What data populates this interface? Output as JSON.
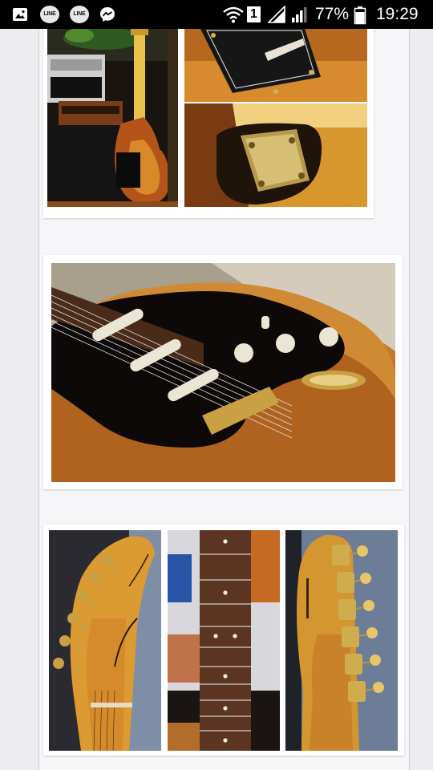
{
  "status_bar": {
    "notifications": [
      "gallery-icon",
      "line-icon",
      "line-icon",
      "messenger-icon"
    ],
    "line_label_1": "LINE",
    "line_label_2": "LINE",
    "sim_slot": "1",
    "battery_percent": "77%",
    "time": "19:29"
  },
  "colors": {
    "page_background": "#ececef",
    "column_background": "#f6f6f8",
    "card_background": "#ffffff"
  },
  "gallery": {
    "photos": [
      {
        "name": "amp-and-guitar-back",
        "icon": "photo"
      },
      {
        "name": "tremolo-cover-plate",
        "icon": "photo"
      },
      {
        "name": "neck-plate",
        "icon": "photo"
      },
      {
        "name": "guitar-body-front",
        "icon": "photo"
      },
      {
        "name": "headstock-front",
        "icon": "photo"
      },
      {
        "name": "fretboard",
        "icon": "photo"
      },
      {
        "name": "headstock-back",
        "icon": "photo"
      }
    ]
  }
}
